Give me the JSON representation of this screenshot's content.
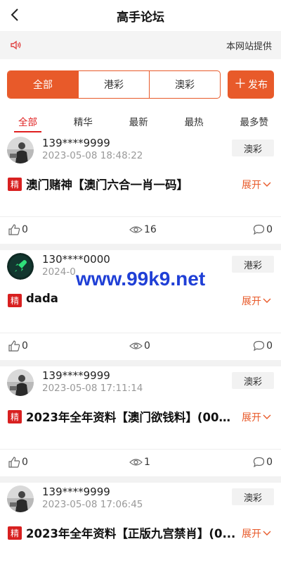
{
  "header": {
    "title": "高手论坛"
  },
  "notice": {
    "text": "本网站提供"
  },
  "segments": [
    {
      "label": "全部",
      "active": true
    },
    {
      "label": "港彩",
      "active": false
    },
    {
      "label": "澳彩",
      "active": false
    }
  ],
  "publish_label": "发布",
  "tabs": [
    {
      "label": "全部",
      "active": true
    },
    {
      "label": "精华",
      "active": false
    },
    {
      "label": "最新",
      "active": false
    },
    {
      "label": "最热",
      "active": false
    },
    {
      "label": "最多赞",
      "active": false
    }
  ],
  "posts": [
    {
      "user": "139****9999",
      "time": "2023-05-08 18:48:22",
      "tag": "澳彩",
      "badge": "精",
      "title": "澳门赌神【澳门六合一肖一码】",
      "expand": "展开",
      "likes": "0",
      "views": "16",
      "comments": "0",
      "avatar": "photo"
    },
    {
      "user": "130****0000",
      "time": "2024-0",
      "tag": "港彩",
      "badge": "精",
      "title": "dada",
      "expand": "展开",
      "likes": "0",
      "views": "0",
      "comments": "0",
      "avatar": "rocket"
    },
    {
      "user": "139****9999",
      "time": "2023-05-08 17:11:14",
      "tag": "澳彩",
      "badge": "精",
      "title": "2023年全年资料【澳门欲钱料】(001...",
      "expand": "展开",
      "likes": "0",
      "views": "1",
      "comments": "0",
      "avatar": "photo"
    },
    {
      "user": "139****9999",
      "time": "2023-05-08 17:06:45",
      "tag": "澳彩",
      "badge": "精",
      "title": "2023年全年资料【正版九宫禁肖】(0...",
      "expand": "展开",
      "likes": "0",
      "views": "",
      "comments": "",
      "avatar": "photo"
    }
  ],
  "watermark": "www.99k9.net",
  "colors": {
    "accent": "#e85a2a",
    "tab_active": "#e02020",
    "badge": "#d82020",
    "watermark": "#1f3fd6"
  }
}
